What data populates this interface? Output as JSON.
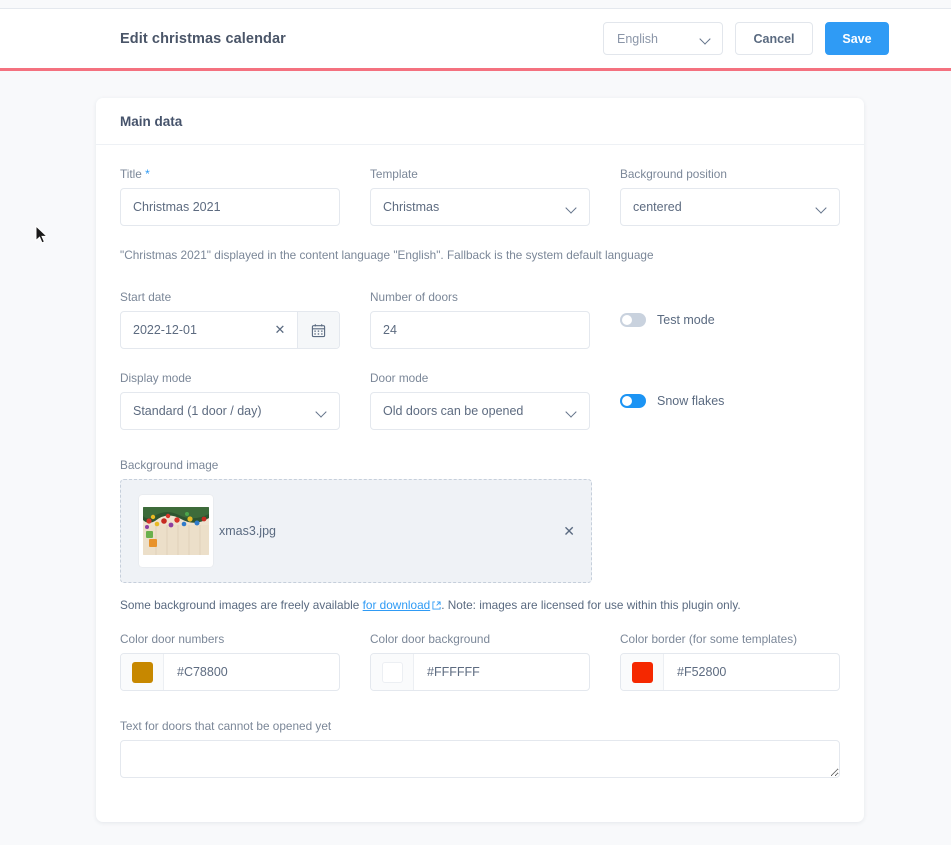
{
  "header": {
    "title": "Edit christmas calendar",
    "language_value": "English",
    "cancel_label": "Cancel",
    "save_label": "Save",
    "accent_color": "#f4717f",
    "save_color": "#2f9bf5"
  },
  "card": {
    "title": "Main data"
  },
  "fields": {
    "title": {
      "label": "Title",
      "required_marker": "*",
      "value": "Christmas 2021"
    },
    "template": {
      "label": "Template",
      "value": "Christmas"
    },
    "background_position": {
      "label": "Background position",
      "value": "centered"
    },
    "title_helper": "\"Christmas 2021\" displayed in the content language \"English\". Fallback is the system default language",
    "start_date": {
      "label": "Start date",
      "value": "2022-12-01",
      "clear_glyph": "✕"
    },
    "number_of_doors": {
      "label": "Number of doors",
      "value": "24"
    },
    "test_mode": {
      "label": "Test mode",
      "state": "off"
    },
    "display_mode": {
      "label": "Display mode",
      "value": "Standard (1 door / day)"
    },
    "door_mode": {
      "label": "Door mode",
      "value": "Old doors can be opened"
    },
    "snow_flakes": {
      "label": "Snow flakes",
      "state": "on"
    },
    "background_image": {
      "label": "Background image",
      "filename": "xmas3.jpg",
      "remove_glyph": "✕"
    },
    "download_note": {
      "before": "Some background images are freely available ",
      "link": "for download",
      "after": ". Note: images are licensed for use within this plugin only."
    },
    "color_door_numbers": {
      "label": "Color door numbers",
      "value": "#C78800",
      "swatch": "#C78800"
    },
    "color_door_background": {
      "label": "Color door background",
      "value": "#FFFFFF",
      "swatch": "#FFFFFF"
    },
    "color_border": {
      "label": "Color border (for some templates)",
      "value": "#F52800",
      "swatch": "#F52800"
    },
    "closed_door_text": {
      "label": "Text for doors that cannot be opened yet",
      "value": "",
      "placeholder": ""
    }
  }
}
